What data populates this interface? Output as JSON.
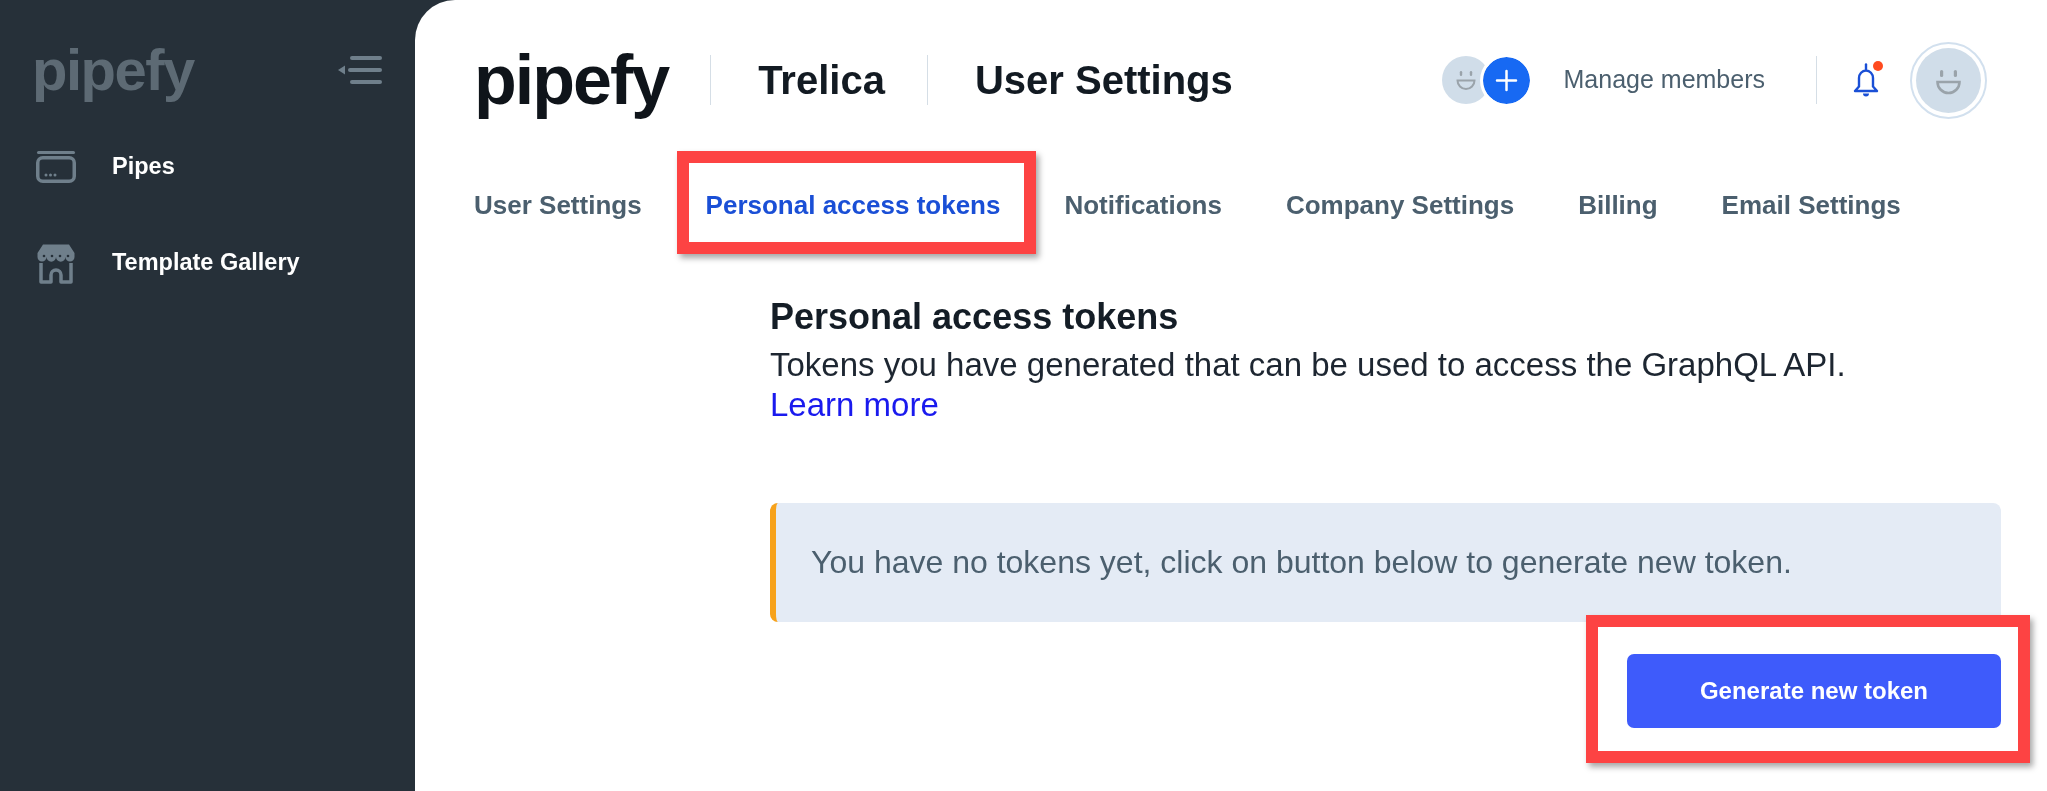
{
  "sidebar": {
    "logo": "pipefy",
    "items": [
      {
        "label": "Pipes",
        "selected": false
      },
      {
        "label": "Template Gallery",
        "selected": false
      }
    ]
  },
  "header": {
    "logo": "pipefy",
    "organization": "Trelica",
    "page_title": "User Settings",
    "manage_members": "Manage members",
    "notifications": {
      "unread": true
    }
  },
  "tabs": [
    {
      "label": "User Settings",
      "selected": false,
      "highlighted": false
    },
    {
      "label": "Personal access tokens",
      "selected": true,
      "highlighted": true
    },
    {
      "label": "Notifications",
      "selected": false,
      "highlighted": false
    },
    {
      "label": "Company Settings",
      "selected": false,
      "highlighted": false
    },
    {
      "label": "Billing",
      "selected": false,
      "highlighted": false
    },
    {
      "label": "Email Settings",
      "selected": false,
      "highlighted": false
    }
  ],
  "section": {
    "title": "Personal access tokens",
    "description": "Tokens you have generated that can be used to access the GraphQL API.",
    "link": "Learn more",
    "notice": "You have no tokens yet, click on button below to generate new token.",
    "button": {
      "label": "Generate new token",
      "highlighted": true
    }
  }
}
